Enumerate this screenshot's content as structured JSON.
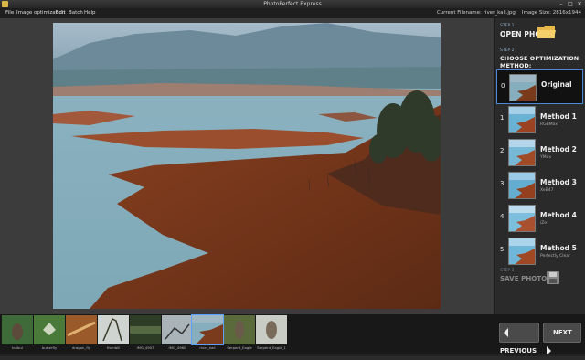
{
  "window": {
    "title": "PhotoPerfect Express"
  },
  "menu": {
    "items": [
      "File",
      "Image optimization",
      "Edit",
      "Batch",
      "Help"
    ],
    "current_filename": "Current Filename: river_kali.jpg",
    "image_size": "Image Size: 2816x1944"
  },
  "panel": {
    "step1": {
      "label": "STEP 1",
      "title": "OPEN PHOTO"
    },
    "step2": {
      "label": "STEP 2",
      "title": "CHOOSE OPTIMIZATION METHOD:"
    },
    "methods": [
      {
        "num": "0",
        "name": "Original",
        "sub": ""
      },
      {
        "num": "1",
        "name": "Method 1",
        "sub": "RGBMax"
      },
      {
        "num": "2",
        "name": "Method 2",
        "sub": "YMax"
      },
      {
        "num": "3",
        "name": "Method 3",
        "sub": "XeB47"
      },
      {
        "num": "4",
        "name": "Method 4",
        "sub": "iZe"
      },
      {
        "num": "5",
        "name": "Method 5",
        "sub": "Perfectly Clear"
      }
    ],
    "step3": {
      "label": "STEP 3",
      "title": "SAVE PHOTO AS"
    }
  },
  "filmstrip": {
    "items": [
      {
        "label": "bulbul"
      },
      {
        "label": "butterfly"
      },
      {
        "label": "dragon_fly"
      },
      {
        "label": "Hornbill"
      },
      {
        "label": "IMG_4907"
      },
      {
        "label": "IMG_4960"
      },
      {
        "label": "river_kali"
      },
      {
        "label": "Serpent_Eagle"
      },
      {
        "label": "Serpent_Eagle_1"
      }
    ],
    "selected_index": 6
  },
  "nav": {
    "previous": "PREVIOUS",
    "next": "NEXT"
  },
  "colors": {
    "accent": "#4a88d8",
    "folder": "#e8b84a",
    "panel_bg": "#2a2a2a"
  }
}
